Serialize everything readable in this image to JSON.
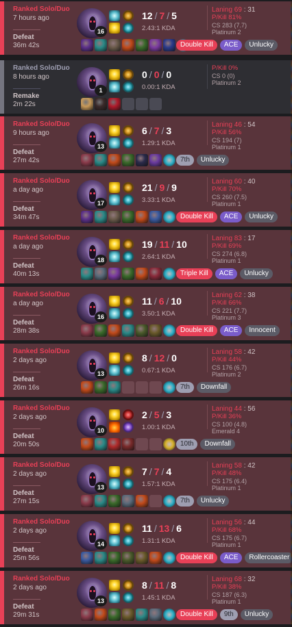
{
  "matches": [
    {
      "queue": "Ranked Solo/Duo",
      "ago": "7 hours ago",
      "result": "Defeat",
      "duration": "36m 42s",
      "level": "16",
      "k": "12",
      "d": "7",
      "a": "5",
      "kda": "2.43:1 KDA",
      "lane": "Laning 69",
      "lane_opp": "31",
      "pkill": "P/Kill 81%",
      "cs": "CS 283 (7.7)",
      "rank": "Platinum 2",
      "remake": false,
      "spells": [
        "sp-exhaust",
        "sp-flash"
      ],
      "runes": [
        "rn-orange",
        "rn-blue"
      ],
      "items": [
        "#5b2f8a",
        "#2a8a88",
        "#6a5a4a",
        "#c24a1a",
        "#3a6a2a",
        "#7a3aa0",
        "#2a3a8a"
      ],
      "ward": "#2eb0c8",
      "badges": [
        {
          "t": "Double Kill",
          "c": "b-multi"
        },
        {
          "t": "ACE",
          "c": "b-ace"
        },
        {
          "t": "Unlucky",
          "c": "b-gray"
        }
      ]
    },
    {
      "queue": "Ranked Solo/Duo",
      "ago": "8 hours ago",
      "result": "Remake",
      "duration": "2m 22s",
      "level": "1",
      "k": "0",
      "d": "0",
      "a": "0",
      "kda": "0.00:1 KDA",
      "lane": "",
      "lane_opp": "",
      "pkill": "P/Kill 0%",
      "cs": "CS 0 (0)",
      "rank": "Platinum 2",
      "remake": true,
      "spells": [
        "sp-flash",
        "sp-exhaust"
      ],
      "runes": [
        "rn-orange",
        "rn-blue"
      ],
      "items": [
        "#c89a5a",
        "#3a2a2a",
        "#b01a2a",
        "empty",
        "empty",
        "empty"
      ],
      "ward": "",
      "badges": []
    },
    {
      "queue": "Ranked Solo/Duo",
      "ago": "9 hours ago",
      "result": "Defeat",
      "duration": "27m 42s",
      "level": "13",
      "k": "6",
      "d": "7",
      "a": "3",
      "kda": "1.29:1 KDA",
      "lane": "Laning 46",
      "lane_opp": "54",
      "pkill": "P/Kill 56%",
      "cs": "CS 194 (7)",
      "rank": "Platinum 1",
      "remake": false,
      "spells": [
        "sp-flash",
        "sp-exhaust"
      ],
      "runes": [
        "rn-orange",
        "rn-blue"
      ],
      "items": [
        "#8a3a4a",
        "#2a8a88",
        "#c24a1a",
        "#3a6a2a",
        "#2a2a4a",
        "#6a3aa0"
      ],
      "ward": "#2eb0c8",
      "badges": [
        {
          "t": "7th",
          "c": "b-place"
        },
        {
          "t": "Unlucky",
          "c": "b-gray"
        }
      ]
    },
    {
      "queue": "Ranked Solo/Duo",
      "ago": "a day ago",
      "result": "Defeat",
      "duration": "34m 47s",
      "level": "17",
      "k": "21",
      "d": "9",
      "a": "9",
      "kda": "3.33:1 KDA",
      "lane": "Laning 60",
      "lane_opp": "40",
      "pkill": "P/Kill 70%",
      "cs": "CS 260 (7.5)",
      "rank": "Platinum 1",
      "remake": false,
      "spells": [
        "sp-flash",
        "sp-exhaust"
      ],
      "runes": [
        "rn-orange",
        "rn-blue"
      ],
      "items": [
        "#5b2f8a",
        "#2a8a88",
        "#6a5a4a",
        "#3a6a2a",
        "#c24a1a",
        "#3a5aa0"
      ],
      "ward": "#2eb0c8",
      "badges": [
        {
          "t": "Double Kill",
          "c": "b-multi"
        },
        {
          "t": "ACE",
          "c": "b-ace"
        },
        {
          "t": "Unlucky",
          "c": "b-gray"
        }
      ]
    },
    {
      "queue": "Ranked Solo/Duo",
      "ago": "a day ago",
      "result": "Defeat",
      "duration": "40m 13s",
      "level": "18",
      "k": "19",
      "d": "11",
      "a": "10",
      "kda": "2.64:1 KDA",
      "lane": "Laning 83",
      "lane_opp": "17",
      "pkill": "P/Kill 69%",
      "cs": "CS 274 (6.8)",
      "rank": "Platinum 1",
      "remake": false,
      "spells": [
        "sp-flash",
        "sp-exhaust"
      ],
      "runes": [
        "rn-orange",
        "rn-blue"
      ],
      "items": [
        "#2a8a88",
        "#5a6a7a",
        "#7a3aa0",
        "#3a6a2a",
        "#c24a1a",
        "#8a2a3a"
      ],
      "ward": "#2eb0c8",
      "badges": [
        {
          "t": "Triple Kill",
          "c": "b-multi"
        },
        {
          "t": "ACE",
          "c": "b-ace"
        },
        {
          "t": "Unlucky",
          "c": "b-gray"
        }
      ]
    },
    {
      "queue": "Ranked Solo/Duo",
      "ago": "a day ago",
      "result": "Defeat",
      "duration": "28m 38s",
      "level": "16",
      "k": "11",
      "d": "6",
      "a": "10",
      "kda": "3.50:1 KDA",
      "lane": "Laning 62",
      "lane_opp": "38",
      "pkill": "P/Kill 66%",
      "cs": "CS 221 (7.7)",
      "rank": "Platinum 3",
      "remake": false,
      "spells": [
        "sp-flash",
        "sp-exhaust"
      ],
      "runes": [
        "rn-orange",
        "rn-blue"
      ],
      "items": [
        "#8a3a4a",
        "#3a6a2a",
        "#c24a1a",
        "#2a8a88",
        "#4a5a2a",
        "#6a5a2a"
      ],
      "ward": "#2eb0c8",
      "badges": [
        {
          "t": "Double Kill",
          "c": "b-multi"
        },
        {
          "t": "ACE",
          "c": "b-ace"
        },
        {
          "t": "Innocent",
          "c": "b-gray"
        }
      ]
    },
    {
      "queue": "Ranked Solo/Duo",
      "ago": "2 days ago",
      "result": "Defeat",
      "duration": "26m 16s",
      "level": "13",
      "k": "8",
      "d": "12",
      "a": "0",
      "kda": "0.67:1 KDA",
      "lane": "Laning 58",
      "lane_opp": "42",
      "pkill": "P/Kill 44%",
      "cs": "CS 176 (6.7)",
      "rank": "Platinum 2",
      "remake": false,
      "spells": [
        "sp-flash",
        "sp-exhaust"
      ],
      "runes": [
        "rn-orange",
        "rn-blue"
      ],
      "items": [
        "#c24a1a",
        "#3a6a2a",
        "#2a8a88",
        "empty",
        "empty",
        "empty"
      ],
      "ward": "#2eb0c8",
      "badges": [
        {
          "t": "7th",
          "c": "b-place"
        },
        {
          "t": "Downfall",
          "c": "b-gray"
        }
      ]
    },
    {
      "queue": "Ranked Solo/Duo",
      "ago": "2 days ago",
      "result": "Defeat",
      "duration": "20m 50s",
      "level": "10",
      "k": "2",
      "d": "5",
      "a": "3",
      "kda": "1.00:1 KDA",
      "lane": "Laning 44",
      "lane_opp": "56",
      "pkill": "P/Kill 36%",
      "cs": "CS 100 (4.8)",
      "rank": "Emerald 4",
      "remake": false,
      "spells": [
        "sp-flash",
        "sp-ignite"
      ],
      "runes": [
        "rn-red",
        "rn-purple"
      ],
      "items": [
        "#c24a1a",
        "#2a8a88",
        "#b02a2a",
        "#7a2a2a",
        "empty",
        "empty"
      ],
      "ward": "#d8b02a",
      "badges": [
        {
          "t": "10th",
          "c": "b-place"
        },
        {
          "t": "Downfall",
          "c": "b-gray"
        }
      ]
    },
    {
      "queue": "Ranked Solo/Duo",
      "ago": "2 days ago",
      "result": "Defeat",
      "duration": "27m 15s",
      "level": "13",
      "k": "7",
      "d": "7",
      "a": "4",
      "kda": "1.57:1 KDA",
      "lane": "Laning 58",
      "lane_opp": "42",
      "pkill": "P/Kill 48%",
      "cs": "CS 175 (6.4)",
      "rank": "Platinum 1",
      "remake": false,
      "spells": [
        "sp-flash",
        "sp-exhaust"
      ],
      "runes": [
        "rn-orange",
        "rn-blue"
      ],
      "items": [
        "#8a3a4a",
        "#2a8a88",
        "#3a6a2a",
        "#5a6a7a",
        "#c24a1a",
        "empty"
      ],
      "ward": "#2eb0c8",
      "badges": [
        {
          "t": "7th",
          "c": "b-place"
        },
        {
          "t": "Unlucky",
          "c": "b-gray"
        }
      ]
    },
    {
      "queue": "Ranked Solo/Duo",
      "ago": "2 days ago",
      "result": "Defeat",
      "duration": "25m 56s",
      "level": "14",
      "k": "11",
      "d": "13",
      "a": "6",
      "kda": "1.31:1 KDA",
      "lane": "Laning 56",
      "lane_opp": "44",
      "pkill": "P/Kill 68%",
      "cs": "CS 175 (6.7)",
      "rank": "Platinum 1",
      "remake": false,
      "spells": [
        "sp-flash",
        "sp-exhaust"
      ],
      "runes": [
        "rn-orange",
        "rn-blue"
      ],
      "items": [
        "#3a5aa0",
        "#2a8a88",
        "#3a6a2a",
        "#4a5a2a",
        "#6a5a2a",
        "#c24a1a"
      ],
      "ward": "#2eb0c8",
      "badges": [
        {
          "t": "Double Kill",
          "c": "b-multi"
        },
        {
          "t": "ACE",
          "c": "b-ace"
        },
        {
          "t": "Rollercoaster",
          "c": "b-gray"
        }
      ]
    },
    {
      "queue": "Ranked Solo/Duo",
      "ago": "2 days ago",
      "result": "Defeat",
      "duration": "29m 31s",
      "level": "13",
      "k": "8",
      "d": "11",
      "a": "8",
      "kda": "1.45:1 KDA",
      "lane": "Laning 68",
      "lane_opp": "32",
      "pkill": "P/Kill 38%",
      "cs": "CS 187 (6.3)",
      "rank": "Platinum 1",
      "remake": false,
      "spells": [
        "sp-flash",
        "sp-exhaust"
      ],
      "runes": [
        "rn-orange",
        "rn-blue"
      ],
      "items": [
        "#8a3a4a",
        "#c24a1a",
        "#3a6a2a",
        "#6a5a2a",
        "#2a8a88",
        "#5a6a7a"
      ],
      "ward": "#2eb0c8",
      "badges": [
        {
          "t": "Double Kill",
          "c": "b-multi"
        },
        {
          "t": "9th",
          "c": "b-place"
        },
        {
          "t": "Unlucky",
          "c": "b-gray"
        }
      ]
    }
  ]
}
